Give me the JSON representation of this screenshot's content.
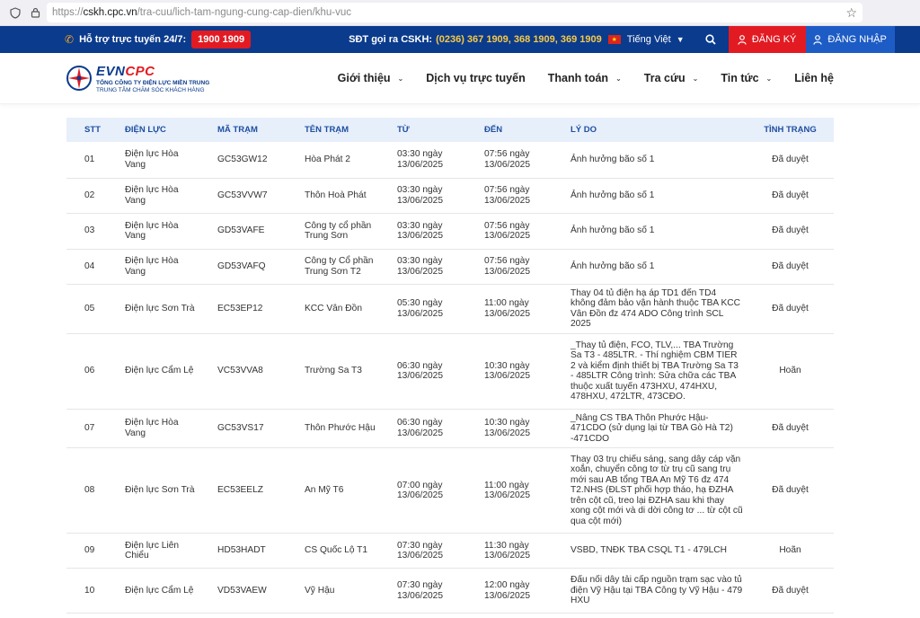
{
  "browser": {
    "url_host": "cskh.cpc.vn",
    "url_path": "/tra-cuu/lich-tam-ngung-cung-cap-dien/khu-vuc",
    "url_prefix": "https://"
  },
  "topbar": {
    "hotline_label": "Hỗ trợ trực tuyến 24/7:",
    "hotline_number": "1900 1909",
    "cskh_label": "SĐT gọi ra CSKH:",
    "cskh_numbers": "(0236) 367 1909, 368 1909, 369 1909",
    "language": "Tiếng Việt",
    "register_label": "ĐĂNG KÝ",
    "login_label": "ĐĂNG NHẬP"
  },
  "header": {
    "brand_evn": "EVN",
    "brand_cpc": "CPC",
    "company_line1": "TỔNG CÔNG TY ĐIỆN LỰC MIỀN TRUNG",
    "company_line2": "TRUNG TÂM CHĂM SÓC KHÁCH HÀNG",
    "nav": [
      {
        "label": "Giới thiệu",
        "dropdown": true
      },
      {
        "label": "Dịch vụ trực tuyến",
        "dropdown": false
      },
      {
        "label": "Thanh toán",
        "dropdown": true
      },
      {
        "label": "Tra cứu",
        "dropdown": true
      },
      {
        "label": "Tin tức",
        "dropdown": true
      },
      {
        "label": "Liên hệ",
        "dropdown": false
      }
    ]
  },
  "table": {
    "columns": [
      "STT",
      "ĐIỆN LỰC",
      "MÃ TRẠM",
      "TÊN TRẠM",
      "TỪ",
      "ĐẾN",
      "LÝ DO",
      "TÌNH TRẠNG"
    ],
    "rows": [
      {
        "stt": "01",
        "dienluc": "Điện lực Hòa Vang",
        "ma": "GC53GW12",
        "ten": "Hòa Phát 2",
        "tu": "03:30 ngày 13/06/2025",
        "den": "07:56 ngày 13/06/2025",
        "lydo": "Ảnh hưởng bão số 1",
        "tt": "Đã duyệt",
        "h": 40
      },
      {
        "stt": "02",
        "dienluc": "Điện lực Hòa Vang",
        "ma": "GC53VVW7",
        "ten": "Thôn Hoà Phát",
        "tu": "03:30 ngày 13/06/2025",
        "den": "07:56 ngày 13/06/2025",
        "lydo": "Ảnh hưởng bão số 1",
        "tt": "Đã duyệt",
        "h": 39
      },
      {
        "stt": "03",
        "dienluc": "Điện lực Hòa Vang",
        "ma": "GD53VAFE",
        "ten": "Công ty cổ phần Trung Sơn",
        "tu": "03:30 ngày 13/06/2025",
        "den": "07:56 ngày 13/06/2025",
        "lydo": "Ảnh hưởng bão số 1",
        "tt": "Đã duyệt",
        "h": 40
      },
      {
        "stt": "04",
        "dienluc": "Điện lực Hòa Vang",
        "ma": "GD53VAFQ",
        "ten": "Công ty Cổ phần Trung Sơn T2",
        "tu": "03:30 ngày 13/06/2025",
        "den": "07:56 ngày 13/06/2025",
        "lydo": "Ảnh hưởng bão số 1",
        "tt": "Đã duyệt",
        "h": 39
      },
      {
        "stt": "05",
        "dienluc": "Điện lực Sơn Trà",
        "ma": "EC53EP12",
        "ten": "KCC Vân Đồn",
        "tu": "05:30 ngày 13/06/2025",
        "den": "11:00 ngày 13/06/2025",
        "lydo": "Thay 04 tủ điện hạ áp TD1 đến TD4 không đảm bảo vận hành thuộc TBA KCC Vân Đồn đz 474 ADO Công trình SCL 2025",
        "tt": "Đã duyệt",
        "h": 50
      },
      {
        "stt": "06",
        "dienluc": "Điện lực Cẩm Lệ",
        "ma": "VC53VVA8",
        "ten": "Trường Sa T3",
        "tu": "06:30 ngày 13/06/2025",
        "den": "10:30 ngày 13/06/2025",
        "lydo": "_Thay tủ điện, FCO, TLV,... TBA Trường Sa T3 - 485LTR. - Thí nghiệm CBM TIER 2 và kiểm định thiết bị TBA Trường Sa T3 - 485LTR Công trình: Sửa chữa các TBA thuộc xuất tuyến 473HXU, 474HXU, 478HXU, 472LTR, 473CĐO.",
        "tt": "Hoãn",
        "h": 84
      },
      {
        "stt": "07",
        "dienluc": "Điện lực Hòa Vang",
        "ma": "GC53VS17",
        "ten": "Thôn Phước Hậu",
        "tu": "06:30 ngày 13/06/2025",
        "den": "10:30 ngày 13/06/2025",
        "lydo": "_Nâng CS TBA Thôn Phước Hậu-471CDO (sử dụng lại từ TBA Gò Hà T2) -471CDO",
        "tt": "Đã duyệt",
        "h": 39
      },
      {
        "stt": "08",
        "dienluc": "Điện lực Sơn Trà",
        "ma": "EC53EELZ",
        "ten": "An Mỹ T6",
        "tu": "07:00 ngày 13/06/2025",
        "den": "11:00 ngày 13/06/2025",
        "lydo": "Thay 03 trụ chiếu sáng, sang dây cáp vặn xoắn, chuyển công tơ từ trụ cũ sang trụ mới sau AB tổng TBA An Mỹ T6 đz 474 T2.NHS (ĐLST phối hợp tháo, hạ ĐZHA trên cột cũ, treo lại ĐZHA sau khi thay xong cột mới và di dời công tơ ... từ cột cũ qua cột mới)",
        "tt": "Đã duyệt",
        "h": 95
      },
      {
        "stt": "09",
        "dienluc": "Điện lực Liên Chiểu",
        "ma": "HD53HADT",
        "ten": "CS Quốc Lộ T1",
        "tu": "07:30 ngày 13/06/2025",
        "den": "11:30 ngày 13/06/2025",
        "lydo": "VSBD, TNĐK TBA CSQL T1 - 479LCH",
        "tt": "Hoãn",
        "h": 39
      },
      {
        "stt": "10",
        "dienluc": "Điện lực Cẩm Lệ",
        "ma": "VD53VAEW",
        "ten": "Vỹ Hậu",
        "tu": "07:30 ngày 13/06/2025",
        "den": "12:00 ngày 13/06/2025",
        "lydo": "Đấu nối dây tải cấp nguồn trạm sạc vào tủ điện Vỹ Hậu tại TBA Công ty Vỹ Hậu - 479 HXU",
        "tt": "Đã duyệt",
        "h": 50
      }
    ]
  },
  "colors": {
    "topbar_bg": "#0b3b8c",
    "accent_red": "#e21b23",
    "login_blue": "#1e5cc5",
    "table_head_bg": "#e7effb",
    "highlight_yellow": "#f7c948"
  }
}
